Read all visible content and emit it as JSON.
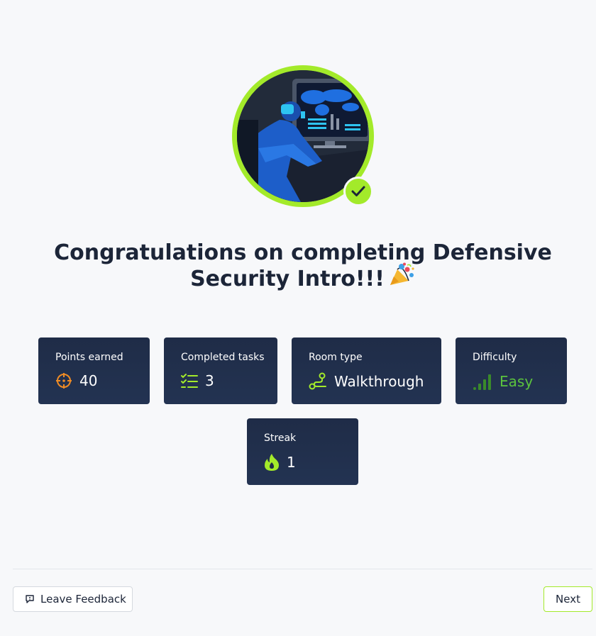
{
  "completion": {
    "title": "Congratulations on completing Defensive Security Intro!!!",
    "badge_icon": "check-icon",
    "accent_color": "#a3ea2a"
  },
  "stats": [
    {
      "label": "Points earned",
      "value": "40",
      "icon": "crosshair-icon",
      "icon_color": "#f08c24"
    },
    {
      "label": "Completed tasks",
      "value": "3",
      "icon": "checklist-icon",
      "icon_color": "#a3ea2a"
    },
    {
      "label": "Room type",
      "value": "Walkthrough",
      "icon": "route-icon",
      "icon_color": "#a3ea2a"
    },
    {
      "label": "Difficulty",
      "value": "Easy",
      "icon": "signal-bars-icon",
      "icon_color": "#5bc33e"
    },
    {
      "label": "Streak",
      "value": "1",
      "icon": "flame-icon",
      "icon_color": "#a3ea2a"
    }
  ],
  "footer": {
    "feedback_label": "Leave Feedback",
    "next_label": "Next"
  }
}
